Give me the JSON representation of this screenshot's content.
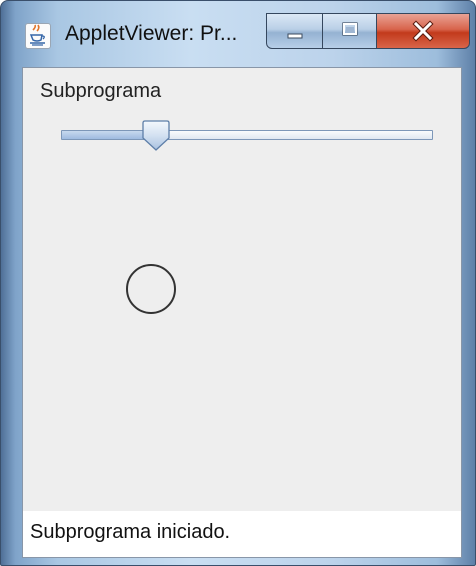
{
  "window": {
    "title": "AppletViewer: Pr...",
    "icon": "java-icon",
    "buttons": {
      "minimize": "minimize-icon",
      "maximize": "maximize-icon",
      "close": "close-icon"
    }
  },
  "applet": {
    "label": "Subprograma",
    "slider": {
      "value_fraction": 0.25
    }
  },
  "status": {
    "text": "Subprograma iniciado."
  },
  "colors": {
    "client_bg": "#eeeeee",
    "close_red": "#c23a1c",
    "slider_border": "#7d97b8"
  }
}
